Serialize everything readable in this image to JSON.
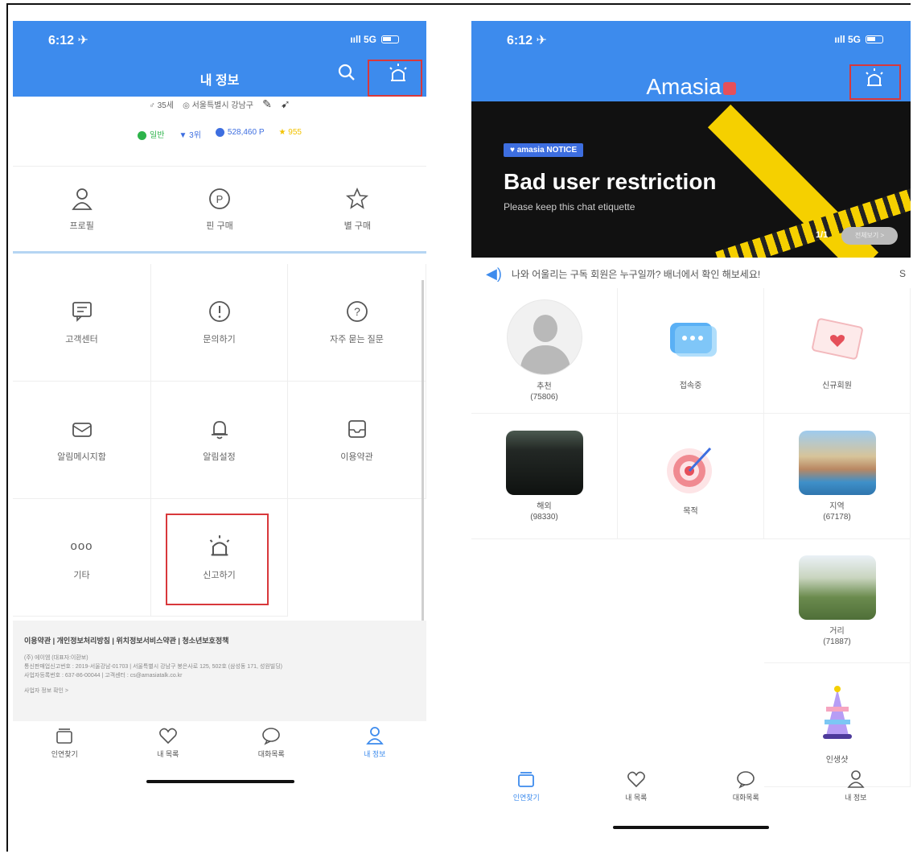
{
  "left_screen": {
    "status": {
      "time": "6:12 ✈",
      "signal": "ııll 5G"
    },
    "header": {
      "title": "내 정보",
      "search_icon": "search-icon",
      "report_icon": "siren-icon"
    },
    "profile": {
      "gender_age": "♂ 35세",
      "location": "◎ 서울특별시 강남구",
      "edit_icon": "pencil-icon",
      "share_icon": "share-icon"
    },
    "stats": {
      "grade": "일반",
      "rank": "3위",
      "points": "528,460 P",
      "stars": "955"
    },
    "top_menu": [
      {
        "label": "프로필",
        "icon": "person-icon"
      },
      {
        "label": "핀 구매",
        "icon": "p-circle-icon"
      },
      {
        "label": "별 구매",
        "icon": "star-icon"
      }
    ],
    "grid": [
      {
        "label": "고객센터",
        "icon": "chat-doc-icon"
      },
      {
        "label": "문의하기",
        "icon": "exclamation-icon"
      },
      {
        "label": "자주 묻는 질문",
        "icon": "question-icon"
      },
      {
        "label": "알림메시지함",
        "icon": "mail-icon"
      },
      {
        "label": "알림설정",
        "icon": "bell-icon"
      },
      {
        "label": "이용약관",
        "icon": "inbox-icon"
      },
      {
        "label": "기타",
        "icon_text": "ooo"
      },
      {
        "label": "신고하기",
        "icon": "siren-icon"
      }
    ],
    "footer": {
      "links": "이용약관 | 개인정보처리방침 | 위치정보서비스약관 | 청소년보호정책",
      "company": "(주) 에이엠 (대표자:이환보)",
      "registration": "통신판매업신고번호 : 2019-서울강남-01703 | 서울특별시 강남구 봉은사로 125, 502호 (삼성동 171, 성원빌딩)",
      "business": "사업자등록번호 : 637-86-00044 | 고객센터 : cs@amasiatalk.co.kr",
      "more": "사업자 정보 확인 >"
    },
    "tabs": [
      {
        "label": "인연찾기",
        "icon": "cards-icon"
      },
      {
        "label": "내 목록",
        "icon": "heart-icon"
      },
      {
        "label": "대화목록",
        "icon": "speech-bubble-icon"
      },
      {
        "label": "내 정보",
        "icon": "person-icon",
        "active": true
      }
    ]
  },
  "right_screen": {
    "status": {
      "time": "6:12 ✈",
      "signal": "ııll 5G"
    },
    "header": {
      "logo": "Amasia",
      "report_icon": "siren-icon"
    },
    "banner": {
      "chip": "♥ amasia  NOTICE",
      "title": "Bad user restriction",
      "subtitle": "Please keep this chat etiquette",
      "counter": "1/1",
      "button": "전체보기 >"
    },
    "ticker": "나와 어울리는 구독 회원은 누구일까? 배너에서 확인 해보세요!",
    "ticker_tail": "S",
    "grid": [
      {
        "label": "추천",
        "count": "(75806)",
        "thumb": "avatar"
      },
      {
        "label": "접속중",
        "count": "",
        "thumb": "chat"
      },
      {
        "label": "신규회원",
        "count": "",
        "thumb": "letter"
      },
      {
        "label": "해외",
        "count": "(98330)",
        "thumb": "sea"
      },
      {
        "label": "목적",
        "count": "",
        "thumb": "target"
      },
      {
        "label": "지역",
        "count": "(67178)",
        "thumb": "venice"
      }
    ],
    "stack": [
      {
        "label": "거리",
        "count": "(71887)",
        "thumb": "hills"
      },
      {
        "label": "인생샷",
        "count": "",
        "thumb": "cake"
      }
    ],
    "tabs": [
      {
        "label": "인연찾기",
        "icon": "cards-icon",
        "active": true
      },
      {
        "label": "내 목록",
        "icon": "heart-icon"
      },
      {
        "label": "대화목록",
        "icon": "speech-bubble-icon"
      },
      {
        "label": "내 정보",
        "icon": "person-icon"
      }
    ]
  },
  "colors": {
    "primary": "#3d8bed",
    "highlight": "#d8383b",
    "tape": "#f5d000"
  }
}
